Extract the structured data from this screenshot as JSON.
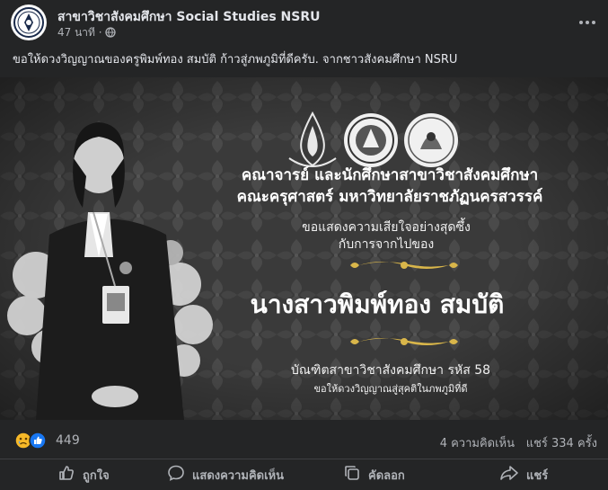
{
  "header": {
    "page_name": "สาขาวิชาสังคมศึกษา Social Studies NSRU",
    "timestamp": "47 นาที",
    "separator": "·",
    "privacy_icon": "globe-icon",
    "more_icon": "more-dots-icon"
  },
  "caption": "ขอให้ดวงวิญญาณของครูพิมพ์ทอง สมบัติ ก้าวสู่ภพภูมิที่ดีครับ. จากชาวสังคมศึกษา NSRU",
  "poster": {
    "line1": "คณาจารย์ และนักศึกษาสาขาวิชาสังคมศึกษา",
    "line2": "คณะครุศาสตร์ มหาวิทยาลัยราชภัฏนครสวรรค์",
    "line3": "ขอแสดงความเสียใจอย่างสุดซึ้ง",
    "line4": "กับการจากไปของ",
    "name": "นางสาวพิมพ์ทอง สมบัติ",
    "line5": "บัณฑิตสาขาวิชาสังคมศึกษา รหัส 58",
    "line6": "ขอให้ดวงวิญญาณสู่สุคติในภพภูมิที่ดี"
  },
  "stats": {
    "reaction_icons": [
      "sad-reaction-icon",
      "like-reaction-icon"
    ],
    "reaction_count": "449",
    "comments": "4 ความคิดเห็น",
    "shares": "แชร์ 334 ครั้ง"
  },
  "actions": {
    "like": "ถูกใจ",
    "comment": "แสดงความคิดเห็น",
    "copy": "คัดลอก",
    "share": "แชร์"
  },
  "colors": {
    "background": "#242526",
    "text_primary": "#e4e6eb",
    "text_secondary": "#b0b3b8",
    "poster_gold": "#d9b64a"
  }
}
